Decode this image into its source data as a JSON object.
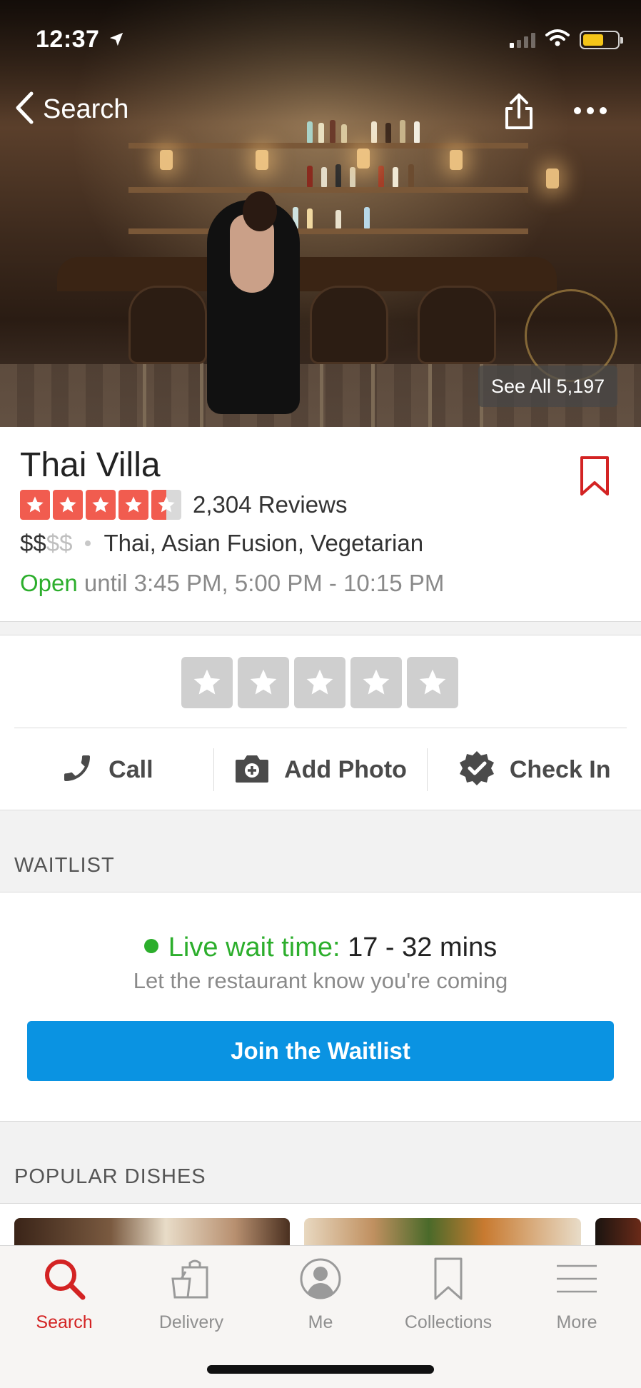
{
  "status_bar": {
    "time": "12:37"
  },
  "nav": {
    "back_label": "Search"
  },
  "hero": {
    "see_all_label": "See All 5,197"
  },
  "business": {
    "name": "Thai Villa",
    "rating": 4.5,
    "review_count": "2,304 Reviews",
    "price_active": "$$",
    "price_inactive": "$$",
    "categories": "Thai, Asian Fusion, Vegetarian",
    "open_label": "Open",
    "hours": "until 3:45 PM, 5:00 PM - 10:15 PM"
  },
  "actions": [
    {
      "label": "Call",
      "icon": "phone-icon"
    },
    {
      "label": "Add Photo",
      "icon": "camera-icon"
    },
    {
      "label": "Check In",
      "icon": "check-badge-icon"
    }
  ],
  "waitlist": {
    "header": "WAITLIST",
    "live_label": "Live wait time:",
    "wait_time": "17 - 32 mins",
    "subtitle": "Let the restaurant know you're coming",
    "button_label": "Join the Waitlist"
  },
  "popular_dishes": {
    "header": "POPULAR DISHES"
  },
  "tabs": [
    {
      "label": "Search",
      "icon": "search-icon",
      "active": true
    },
    {
      "label": "Delivery",
      "icon": "delivery-bag-icon",
      "active": false
    },
    {
      "label": "Me",
      "icon": "profile-icon",
      "active": false
    },
    {
      "label": "Collections",
      "icon": "bookmark-icon",
      "active": false
    },
    {
      "label": "More",
      "icon": "menu-icon",
      "active": false
    }
  ],
  "colors": {
    "brand_red": "#d32323",
    "star_red": "#f15c4f",
    "open_green": "#2cae2c",
    "button_blue": "#0a93e2",
    "battery_yellow": "#f5c518"
  }
}
